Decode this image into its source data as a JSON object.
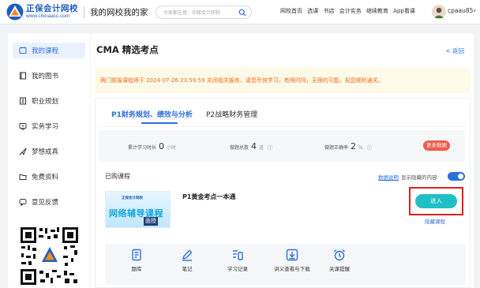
{
  "header": {
    "brand": "正保会计网校",
    "brand_url": "www.chinaacc.com",
    "home_title": "我的网校我的家",
    "search_placeholder": "大家都在搜：中级会计职称",
    "nav": [
      "网校首页",
      "选课",
      "书店",
      "会计实务",
      "继续教育",
      "App看课"
    ],
    "username": "cpaau85",
    "username_chevron": "∨"
  },
  "sidebar": {
    "items": [
      {
        "label": "我的课程",
        "icon": "course-icon",
        "active": true
      },
      {
        "label": "我的图书",
        "icon": "book-icon"
      },
      {
        "label": "职业规划",
        "icon": "career-icon"
      },
      {
        "label": "实务学习",
        "icon": "practice-icon"
      },
      {
        "label": "梦想成真",
        "icon": "dream-icon"
      },
      {
        "label": "免费资料",
        "icon": "folder-icon"
      },
      {
        "label": "意见反馈",
        "icon": "feedback-icon"
      }
    ]
  },
  "main": {
    "title": "CMA 精选考点",
    "back": "< 返回",
    "notice": "两门联报课程将于 2024-07-26 23:59:59 关闭相关服务，请您尽快学习，有限时间，无限的可能，祝您顺利通关。",
    "tabs": [
      {
        "label": "P1财务规划、绩效与分析",
        "active": true
      },
      {
        "label": "P2战略财务管理",
        "active": false
      }
    ],
    "stats": {
      "study_time_label": "累计学习时长",
      "study_time_value": "0",
      "study_time_unit": "小时",
      "questions_label": "做题总数",
      "questions_value": "4",
      "questions_unit": "道",
      "accuracy_label": "做题正确率",
      "accuracy_value": "2",
      "accuracy_unit": "%",
      "info_symbol": "ⓘ",
      "more_data": "更多数据"
    },
    "bought_label": "已购课程",
    "data_explain": "数据说明",
    "show_hidden": "显示隐藏的内容",
    "show_hidden_on": true,
    "course": {
      "thumb_logo": "正保会计网校",
      "thumb_title": "网络辅导课程",
      "thumb_badge": "面授",
      "name": "P1黄金考点一本通",
      "enter": "进入",
      "hide": "隐藏课程"
    },
    "tools": [
      {
        "label": "题库",
        "icon": "question-bank-icon"
      },
      {
        "label": "笔记",
        "icon": "note-icon"
      },
      {
        "label": "学习记录",
        "icon": "study-record-icon"
      },
      {
        "label": "讲义查看与下载",
        "icon": "download-icon"
      },
      {
        "label": "关课提醒",
        "icon": "alarm-clock-icon"
      }
    ]
  },
  "colors": {
    "accent": "#2d6fde",
    "notice_bg": "#fff9e8",
    "notice_text": "#f06a1d",
    "enter_button": "#1ec0c6",
    "highlight": "#e02020",
    "more_data": "#f05b4c"
  }
}
